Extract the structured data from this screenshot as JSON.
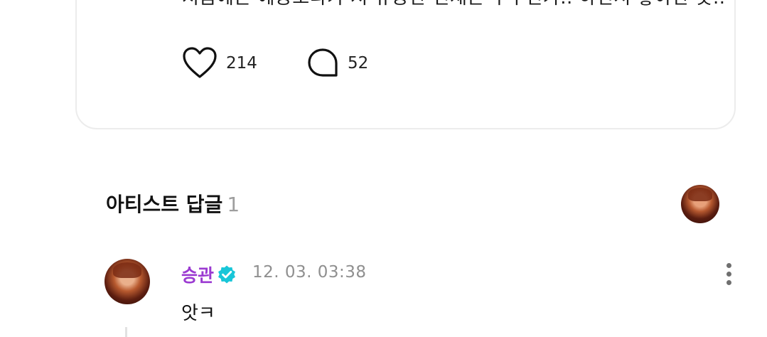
{
  "post": {
    "text": "처음에는 예능보다가 저 유능한 인재는 누구인가.. 하면서 좋아한 듯..",
    "like_icon": "heart-icon",
    "like_count": "214",
    "comment_icon": "speech-bubble-icon",
    "comment_count": "52"
  },
  "artist_replies": {
    "title": "아티스트 답글",
    "count": "1"
  },
  "reply": {
    "author": "승관",
    "verified_icon": "verified-badge-icon",
    "timestamp": "12. 03. 03:38",
    "text": "앗ㅋ",
    "more_icon": "more-vertical-icon"
  },
  "colors": {
    "author": "#9b3ad1",
    "verified": "#18c6d8",
    "muted": "#8f8f8f",
    "card_border": "#ececec"
  }
}
